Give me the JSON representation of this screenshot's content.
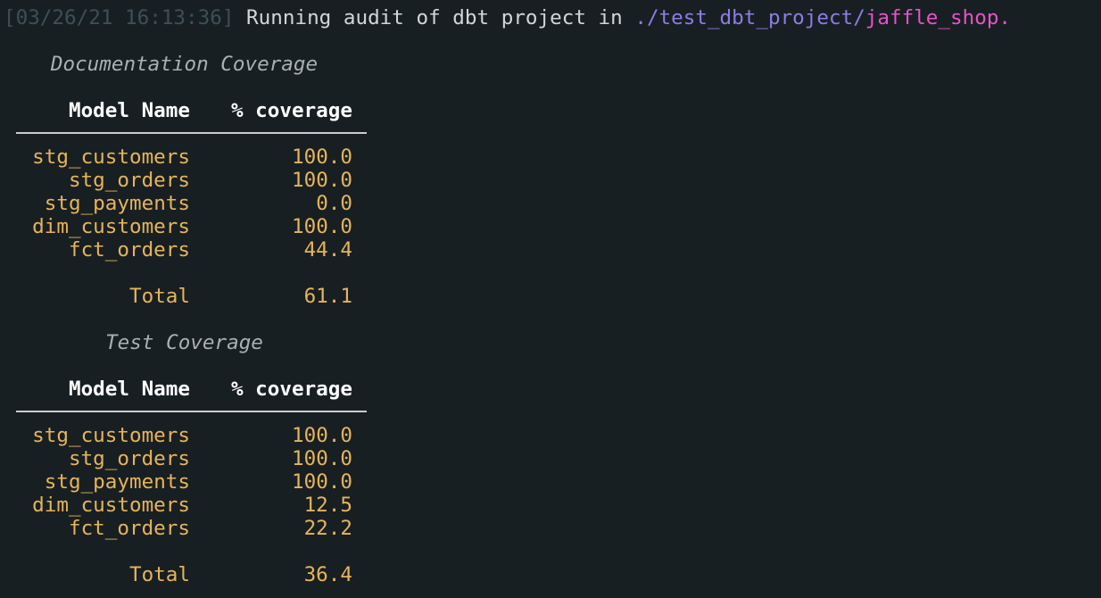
{
  "log_line": {
    "timestamp": "[03/26/21 16:13:36]",
    "message": " Running audit of dbt project in ",
    "path_dir": "./test_dbt_project/",
    "path_file": "jaffle_shop."
  },
  "doc_coverage": {
    "title": "Documentation Coverage",
    "header_name": "Model Name",
    "header_cov": "% coverage",
    "rows": [
      {
        "name": "stg_customers",
        "cov": "100.0"
      },
      {
        "name": "stg_orders",
        "cov": "100.0"
      },
      {
        "name": "stg_payments",
        "cov": "0.0"
      },
      {
        "name": "dim_customers",
        "cov": "100.0"
      },
      {
        "name": "fct_orders",
        "cov": "44.4"
      }
    ],
    "total_label": "Total",
    "total_value": "61.1"
  },
  "test_coverage": {
    "title": "Test Coverage",
    "header_name": "Model Name",
    "header_cov": "% coverage",
    "rows": [
      {
        "name": "stg_customers",
        "cov": "100.0"
      },
      {
        "name": "stg_orders",
        "cov": "100.0"
      },
      {
        "name": "stg_payments",
        "cov": "100.0"
      },
      {
        "name": "dim_customers",
        "cov": "12.5"
      },
      {
        "name": "fct_orders",
        "cov": "22.2"
      }
    ],
    "total_label": "Total",
    "total_value": "36.4"
  },
  "colors": {
    "background": "#181f22",
    "timestamp": "#3d4f59",
    "path_dir": "#8c7ce8",
    "path_file": "#e553c9",
    "values": "#e6b45a"
  }
}
